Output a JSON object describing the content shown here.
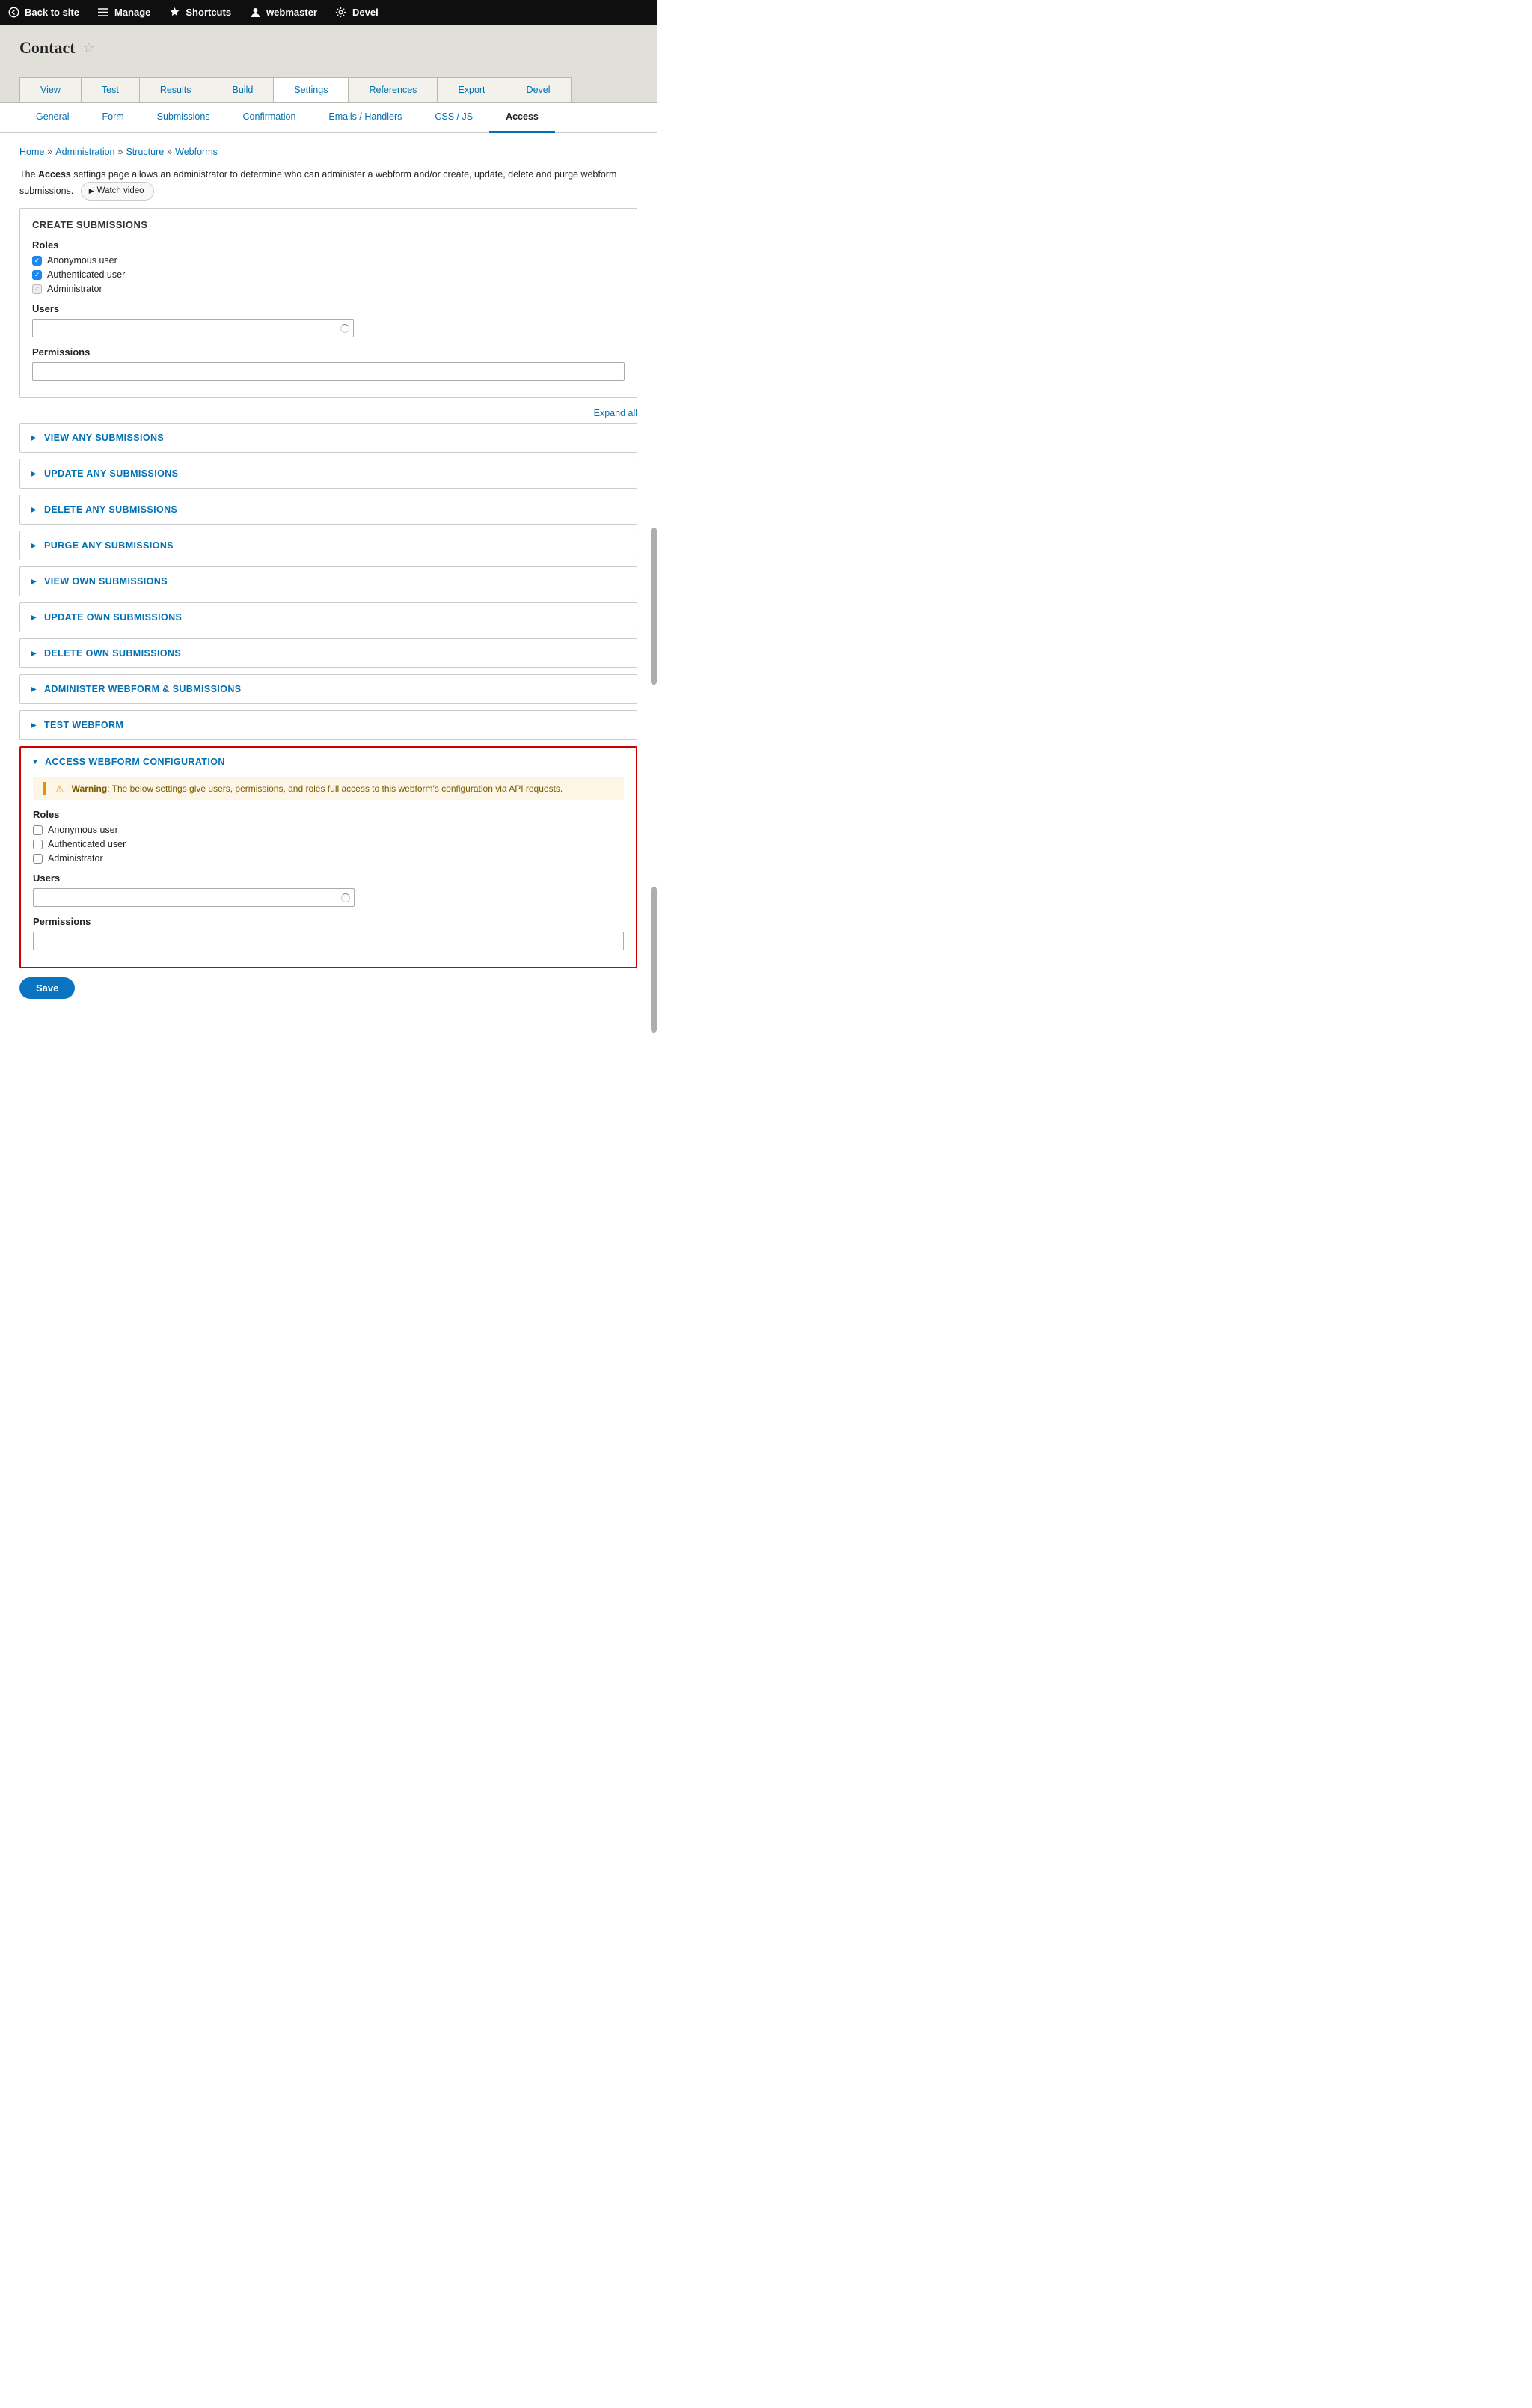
{
  "toolbar": {
    "back": "Back to site",
    "manage": "Manage",
    "shortcuts": "Shortcuts",
    "user": "webmaster",
    "devel": "Devel"
  },
  "page": {
    "title": "Contact"
  },
  "primary_tabs": [
    "View",
    "Test",
    "Results",
    "Build",
    "Settings",
    "References",
    "Export",
    "Devel"
  ],
  "primary_active": "Settings",
  "secondary_tabs": [
    "General",
    "Form",
    "Submissions",
    "Confirmation",
    "Emails / Handlers",
    "CSS / JS",
    "Access"
  ],
  "secondary_active": "Access",
  "breadcrumb": {
    "items": [
      "Home",
      "Administration",
      "Structure",
      "Webforms"
    ]
  },
  "intro": {
    "pre": "The ",
    "strong": "Access",
    "post": " settings page allows an administrator to determine who can administer a webform and/or create, update, delete and purge webform submissions.",
    "video": "Watch video"
  },
  "create_panel": {
    "title": "CREATE SUBMISSIONS",
    "roles_label": "Roles",
    "roles": [
      {
        "label": "Anonymous user",
        "state": "checked"
      },
      {
        "label": "Authenticated user",
        "state": "checked"
      },
      {
        "label": "Administrator",
        "state": "disabled"
      }
    ],
    "users_label": "Users",
    "users_value": "",
    "perm_label": "Permissions",
    "perm_value": ""
  },
  "expand_all": "Expand all",
  "collapsibles": [
    "VIEW ANY SUBMISSIONS",
    "UPDATE ANY SUBMISSIONS",
    "DELETE ANY SUBMISSIONS",
    "PURGE ANY SUBMISSIONS",
    "VIEW OWN SUBMISSIONS",
    "UPDATE OWN SUBMISSIONS",
    "DELETE OWN SUBMISSIONS",
    "ADMINISTER WEBFORM & SUBMISSIONS",
    "TEST WEBFORM"
  ],
  "access_panel": {
    "title": "ACCESS WEBFORM CONFIGURATION",
    "warning_strong": "Warning",
    "warning_text": ": The below settings give users, permissions, and roles full access to this webform's configuration via API requests.",
    "roles_label": "Roles",
    "roles": [
      {
        "label": "Anonymous user",
        "state": "unchecked"
      },
      {
        "label": "Authenticated user",
        "state": "unchecked"
      },
      {
        "label": "Administrator",
        "state": "unchecked"
      }
    ],
    "users_label": "Users",
    "users_value": "",
    "perm_label": "Permissions",
    "perm_value": ""
  },
  "save": "Save"
}
